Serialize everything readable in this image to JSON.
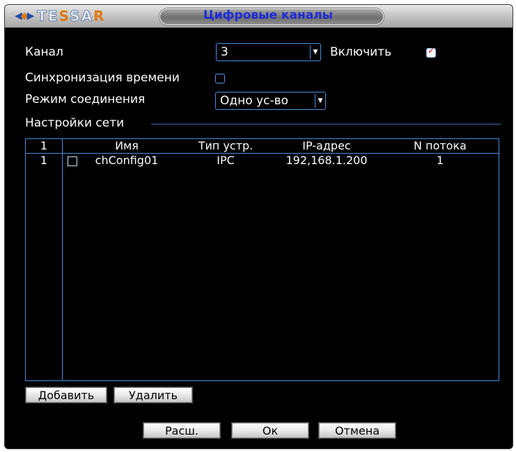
{
  "window": {
    "title": "Цифровые каналы",
    "logo_text": "TESSAR"
  },
  "form": {
    "channel_label": "Канал",
    "channel_value": "3",
    "enable_label": "Включить",
    "enable_checked": true,
    "time_sync_label": "Синхронизация времени",
    "time_sync_checked": false,
    "connection_mode_label": "Режим соединения",
    "connection_mode_value": "Одно ус-во",
    "network_settings_label": "Настройки сети"
  },
  "table": {
    "columns": [
      "1",
      "Имя",
      "Тип устр.",
      "IP-адрес",
      "N потока"
    ],
    "rows": [
      {
        "num": "1",
        "selected": false,
        "name": "chConfig01",
        "type": "IPC",
        "ip": "192,168.1.200",
        "stream": "1"
      }
    ]
  },
  "buttons": {
    "add": "Добавить",
    "delete": "Удалить",
    "advanced": "Расш.",
    "ok": "Ок",
    "cancel": "Отмена"
  },
  "colors": {
    "background": "#000000",
    "accent_border": "#4a8fe0",
    "title_text": "#1d2bd8",
    "check_mark": "#d8181a",
    "logo_accent": "#e07a10"
  }
}
